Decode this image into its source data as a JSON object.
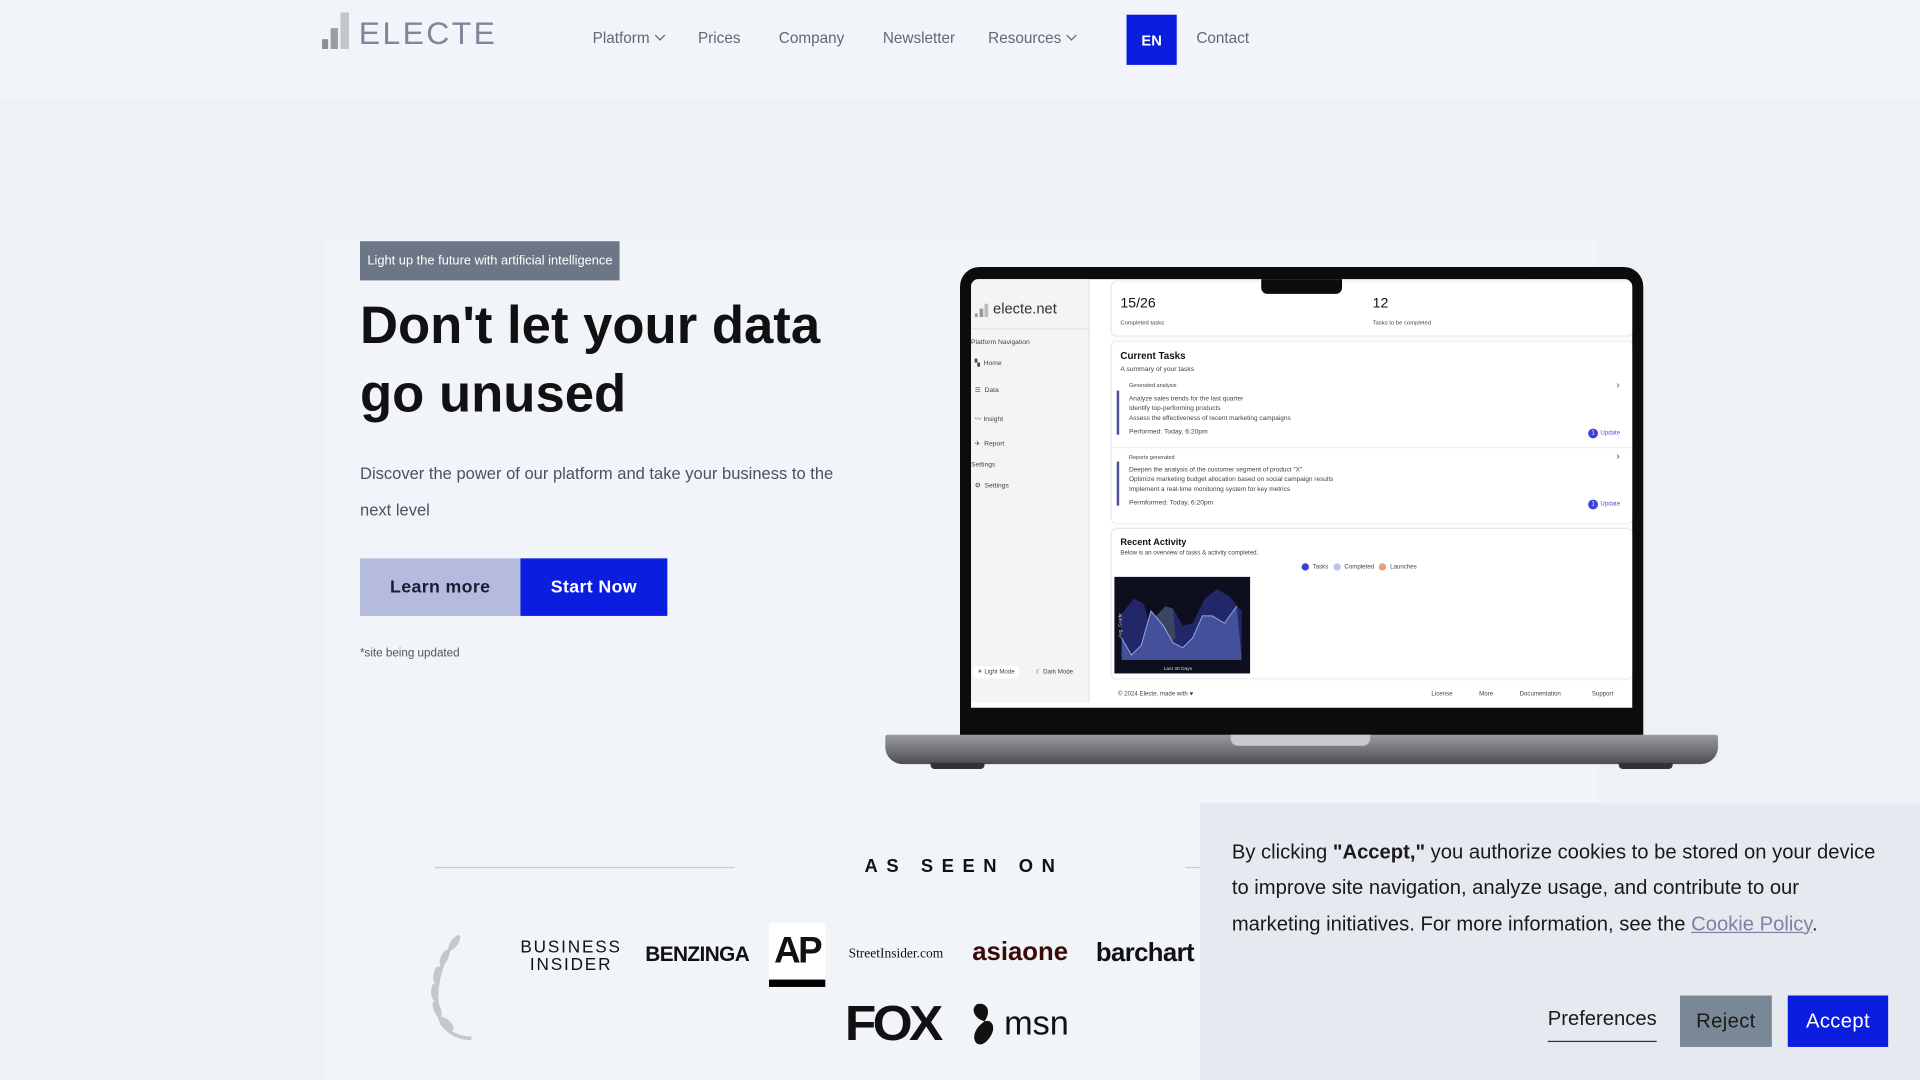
{
  "brand": {
    "name": "ELECTE"
  },
  "nav": {
    "items": [
      {
        "label": "Platform",
        "dropdown": true
      },
      {
        "label": "Prices"
      },
      {
        "label": "Company"
      },
      {
        "label": "Newsletter"
      },
      {
        "label": "Resources",
        "dropdown": true
      }
    ],
    "language": "EN",
    "contact": "Contact"
  },
  "hero": {
    "badge": "Light up the future with artificial intelligence",
    "title": "Don't let your data go unused",
    "subtitle": "Discover the power of our platform and take your business to the next level",
    "learn_more": "Learn more",
    "start_now": "Start Now",
    "note": "*site being updated"
  },
  "mockup": {
    "site": "electe.net",
    "nav_heading": "Platform Navigation",
    "nav": [
      "Home",
      "Data",
      "Insight",
      "Report"
    ],
    "settings_heading": "Settings",
    "settings": "Settings",
    "light_mode": "Light Mode",
    "dark_mode": "Dark Mode",
    "stat1": {
      "value": "15/26",
      "label": "Completed tasks"
    },
    "stat2": {
      "value": "12",
      "label": "Tasks to be completed"
    },
    "current": {
      "title": "Current Tasks",
      "subtitle": "A summary of your tasks",
      "groups": [
        {
          "heading": "Generated analysis",
          "lines": [
            "Analyze sales trends for the last quarter",
            "Identify top-performing products",
            "Assess the effectiveness of recent marketing campaigns"
          ],
          "performed": "Performed: Today, 6:20pm",
          "badge": "1",
          "update": "Update"
        },
        {
          "heading": "Reports generated",
          "lines": [
            "Deepen the analysis of the customer segment of product \"X\"",
            "Optimize marketing budget allocation based on social campaign results",
            "Implement a real-time monitoring system for key metrics"
          ],
          "performed": "Permformed: Today, 6:20pm",
          "badge": "1",
          "update": "Update"
        }
      ]
    },
    "activity": {
      "title": "Recent Activity",
      "subtitle": "Below is an overview of tasks & activity completed.",
      "legend": [
        "Tasks",
        "Completed",
        "Launches"
      ],
      "y_label": "Avg. Grade",
      "x_label": "Last 30 Days"
    },
    "footer": {
      "copyright": "© 2024 Electe, made with ♥",
      "links": [
        "License",
        "More",
        "Documentation",
        "Support"
      ]
    }
  },
  "press": {
    "heading": "AS SEEN ON",
    "logos": [
      "BUSINESS",
      "INSIDER",
      "BENZINGA",
      "AP",
      "StreetInsider.com",
      "asiaone",
      "barchart",
      "FOX",
      "msn"
    ]
  },
  "cookie": {
    "text_before": "By clicking ",
    "accept_quote": "\"Accept,\"",
    "text_after": " you authorize cookies to be stored on your device to improve site navigation, analyze usage, and contribute to our marketing initiatives. For more information, see the ",
    "link": "Cookie Policy",
    "end": ".",
    "preferences": "Preferences",
    "reject": "Reject",
    "accept": "Accept"
  },
  "colors": {
    "accent": "#0b1ee0",
    "learn_more_bg": "#b4bbdc",
    "reject_bg": "#7a8797",
    "badge_bg": "#6c7686"
  }
}
